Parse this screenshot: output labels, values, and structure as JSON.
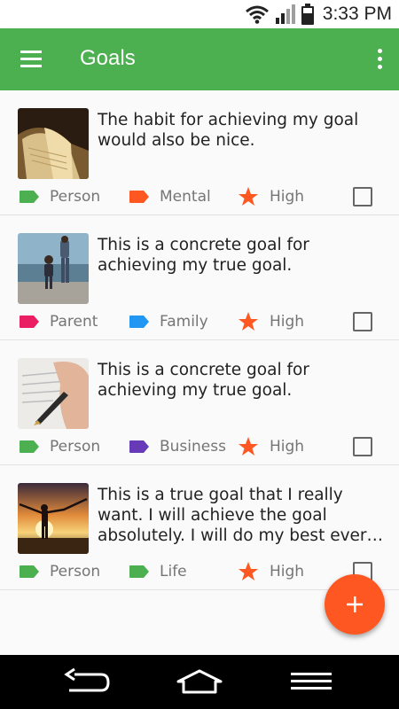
{
  "status_bar": {
    "time": "3:33 PM"
  },
  "app_bar": {
    "title": "Goals"
  },
  "colors": {
    "primary": "#4caf50",
    "accent": "#ff5722",
    "tag_green": "#4caf50",
    "tag_orange": "#ff5722",
    "tag_pink": "#e91e63",
    "tag_blue": "#2196f3",
    "tag_purple": "#673ab7",
    "star": "#ff5722"
  },
  "goals": [
    {
      "text": "The habit for achieving my goal would also be nice.",
      "tag1": "Person",
      "tag2": "Mental",
      "priority": "High",
      "checked": false
    },
    {
      "text": "This is a concrete goal for achieving my true goal.",
      "tag1": "Parent",
      "tag2": "Family",
      "priority": "High",
      "checked": false
    },
    {
      "text": "This is a concrete goal for achieving my true goal.",
      "tag1": "Person",
      "tag2": "Business",
      "priority": "High",
      "checked": false
    },
    {
      "text": "This is a true goal that I really want. I will achieve the goal absolutely. I will do my best every day in order to make it happen.",
      "tag1": "Person",
      "tag2": "Life",
      "priority": "High",
      "checked": false
    }
  ]
}
